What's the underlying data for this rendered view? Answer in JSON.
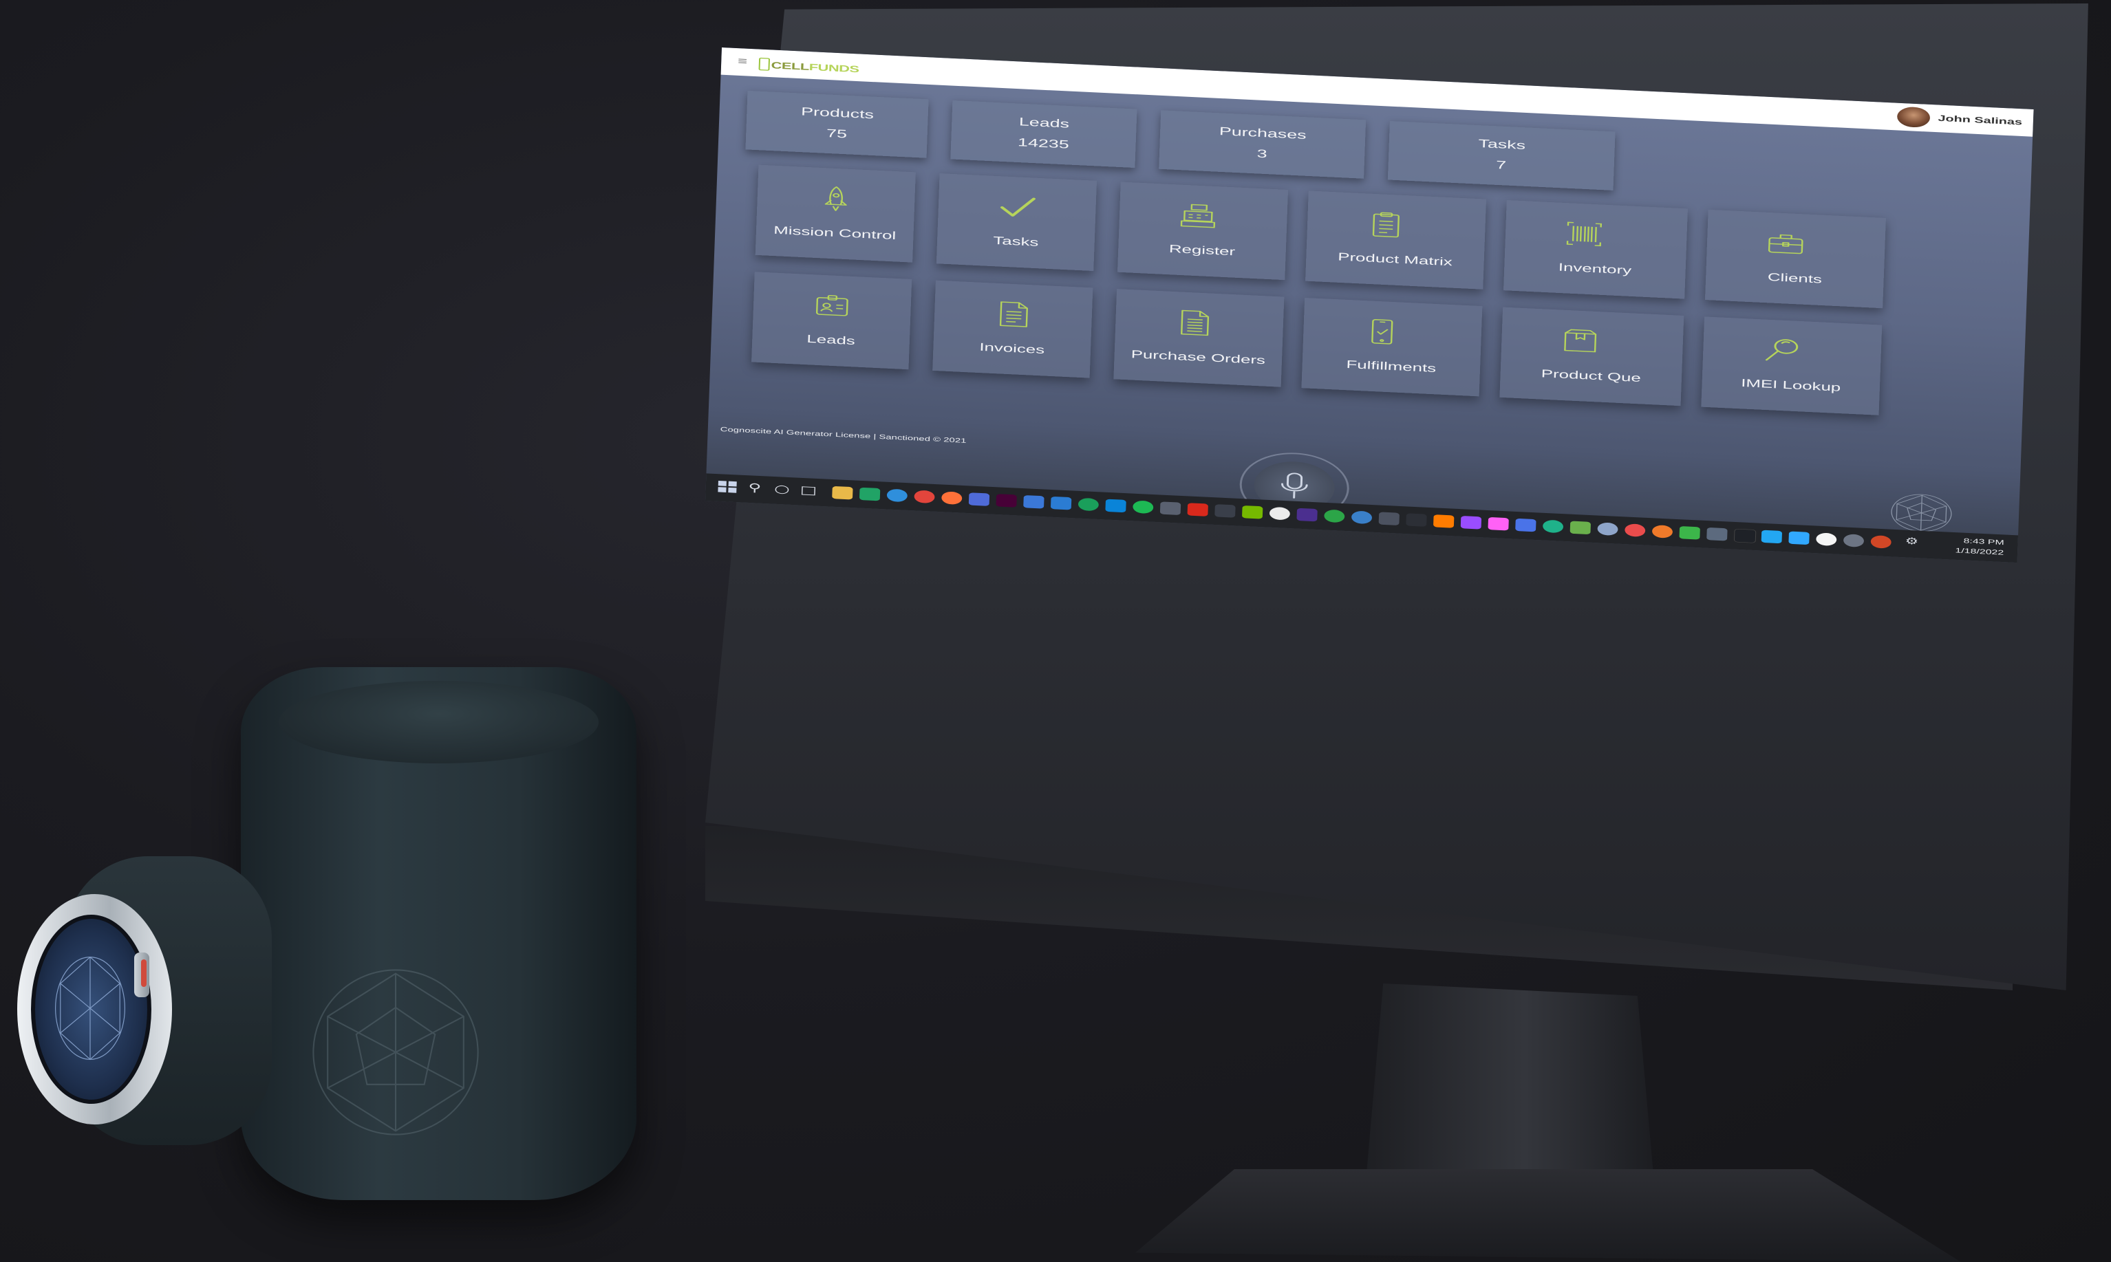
{
  "app": {
    "logo_cell": "CELL",
    "logo_funds": "FUNDS",
    "user_name": "John Salinas"
  },
  "stats": [
    {
      "label": "Products",
      "value": "75"
    },
    {
      "label": "Leads",
      "value": "14235"
    },
    {
      "label": "Purchases",
      "value": "3"
    },
    {
      "label": "Tasks",
      "value": "7"
    }
  ],
  "tiles": [
    {
      "label": "Mission Control",
      "icon": "rocket-icon"
    },
    {
      "label": "Tasks",
      "icon": "checkmark-icon"
    },
    {
      "label": "Register",
      "icon": "cash-register-icon"
    },
    {
      "label": "Product Matrix",
      "icon": "clipboard-list-icon"
    },
    {
      "label": "Inventory",
      "icon": "barcode-icon"
    },
    {
      "label": "Clients",
      "icon": "briefcase-icon"
    },
    {
      "label": "Leads",
      "icon": "id-badge-icon"
    },
    {
      "label": "Invoices",
      "icon": "document-icon"
    },
    {
      "label": "Purchase Orders",
      "icon": "document-list-icon"
    },
    {
      "label": "Fulfillments",
      "icon": "phone-check-icon"
    },
    {
      "label": "Product Que",
      "icon": "box-icon"
    },
    {
      "label": "IMEI Lookup",
      "icon": "magnifier-icon"
    }
  ],
  "footer": {
    "license_text": "Cognoscite AI Generator License | Sanctioned © 2021"
  },
  "taskbar": {
    "time": "8:43 PM",
    "date": "1/18/2022"
  },
  "colors": {
    "accent": "#b6d45b",
    "header_bg": "#ffffff",
    "screen_top": "#6c7898",
    "screen_bottom": "#39404f",
    "taskbar_bg": "#222428"
  }
}
